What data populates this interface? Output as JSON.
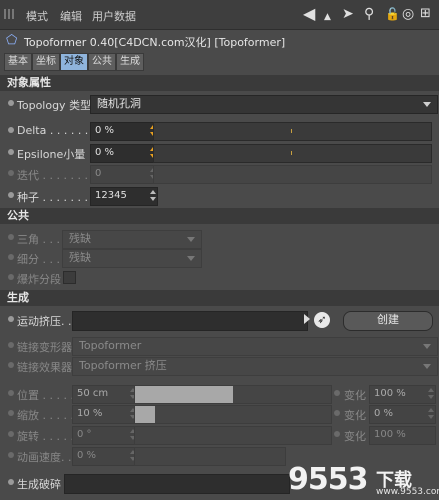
{
  "menu": {
    "items": [
      "模式",
      "编辑",
      "用户数据"
    ]
  },
  "toolbar_icons": [
    "arrow-left-icon",
    "arrow-up-icon",
    "search-icon",
    "lock-icon",
    "target-icon",
    "add-icon"
  ],
  "title": "Topoformer 0.40[C4DCN.com汉化] [Topoformer]",
  "tabs": [
    "基本",
    "坐标",
    "对象",
    "公共",
    "生成"
  ],
  "active_tab": "对象",
  "sections": {
    "object": "对象属性",
    "common": "公共",
    "generate": "生成"
  },
  "object_props": {
    "topology_label": "Topology 类型",
    "topology_value": "随机孔洞",
    "delta_label": "Delta . . . . . . . .",
    "delta_value": "0 %",
    "epsilon_label": "Epsilone小量",
    "epsilon_value": "0 %",
    "iter_label": "迭代 . . . . . . . . .",
    "iter_value": "0",
    "seed_label": "种子 . . . . . . . . .",
    "seed_value": "12345"
  },
  "common_props": {
    "triangle_label": "三角 . . .",
    "triangle_value": "残缺",
    "subdiv_label": "细分 . . .",
    "subdiv_value": "残缺",
    "explode_label": "爆炸分段"
  },
  "generate_props": {
    "motion_label": "运动挤压. . . . . . . .",
    "create_button": "创建",
    "link_deformer_label": "链接变形器",
    "link_deformer_value": "Topoformer",
    "link_effector_label": "链接效果器",
    "link_effector_value": "Topoformer 挤压",
    "position_label": "位置 . . . . .",
    "position_value": "50 cm",
    "position_fill": 0.5,
    "position_var_label": "变化",
    "position_var_value": "100 %",
    "scale_label": "缩放 . . . . .",
    "scale_value": "10 %",
    "scale_fill": 0.1,
    "scale_var_label": "变化",
    "scale_var_value": "0 %",
    "rotation_label": "旋转 . . . . .",
    "rotation_value": "0 °",
    "rotation_var_label": "变化",
    "rotation_var_value": "100 %",
    "anim_speed_label": "动画速度. . .",
    "anim_speed_value": "0 %",
    "gen_break_label": "生成破碎"
  },
  "watermark": {
    "number": "9553",
    "cn": "下载",
    "url": "www.9553.com"
  }
}
